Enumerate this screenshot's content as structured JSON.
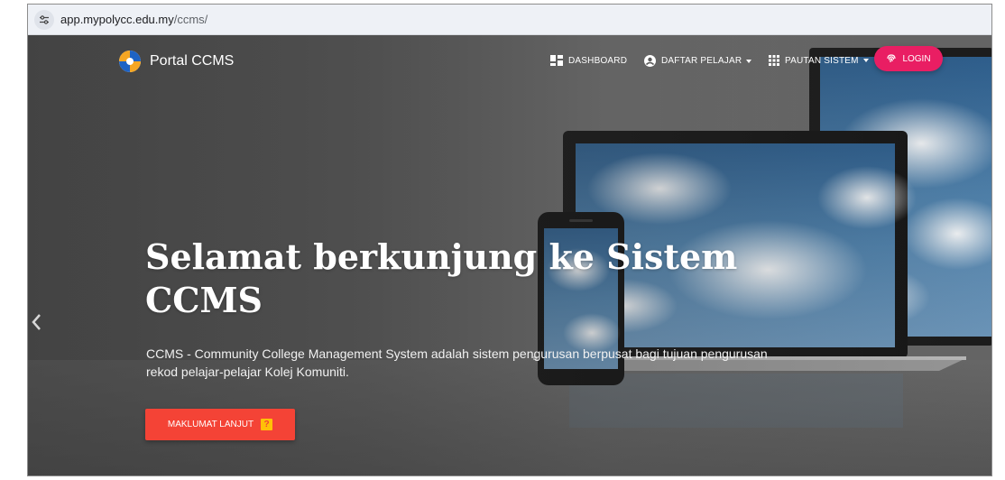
{
  "browser": {
    "url_domain": "app.mypolycc.edu.my",
    "url_path": "/ccms/",
    "site_info_icon": "tune-icon"
  },
  "navbar": {
    "brand_name": "Portal CCMS",
    "brand_logo": "ccms-logo",
    "items": [
      {
        "label": "DASHBOARD",
        "icon": "dashboard-icon",
        "dropdown": false
      },
      {
        "label": "DAFTAR PELAJAR",
        "icon": "account-circle-icon",
        "dropdown": true
      },
      {
        "label": "PAUTAN SISTEM",
        "icon": "apps-icon",
        "dropdown": true
      }
    ],
    "login": {
      "label": "LOGIN",
      "icon": "fingerprint-icon",
      "color": "#e91e63"
    }
  },
  "hero": {
    "headline": "Selamat berkunjung ke Sistem CCMS",
    "description": "CCMS - Community College Management System adalah sistem pengurusan berpusat bagi tujuan pengurusan rekod pelajar-pelajar Kolej Komuniti.",
    "cta_label": "MAKLUMAT LANJUT",
    "cta_icon": "help-icon",
    "cta_color": "#f44336",
    "prev_icon": "chevron-left-icon"
  }
}
